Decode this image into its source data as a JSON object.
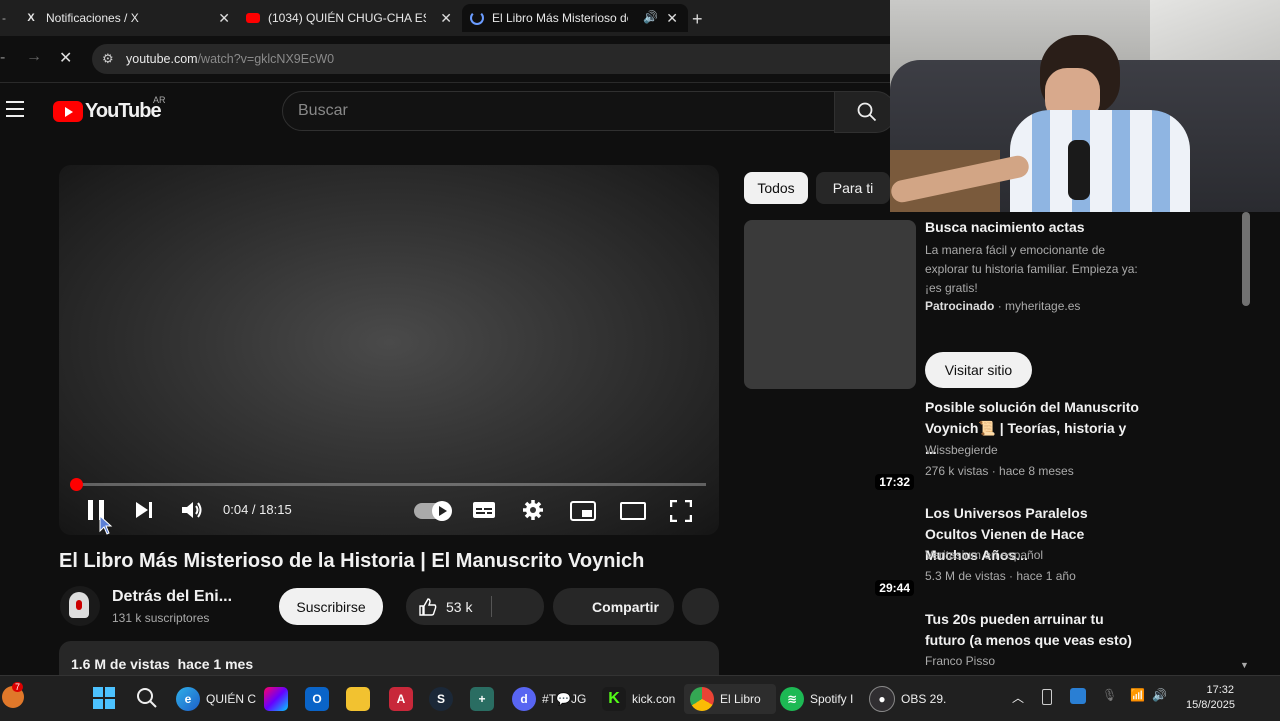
{
  "browser": {
    "tabs": [
      {
        "title": "Notificaciones / X"
      },
      {
        "title": "(1034) QUIÉN CHUG-CHA ES PA"
      },
      {
        "title": "El Libro Más Misterioso de l"
      }
    ],
    "url_host": "youtube.com",
    "url_path": "/watch?v=gklcNX9EcW0"
  },
  "header": {
    "logo_text": "YouTube",
    "country": "AR",
    "search_placeholder": "Buscar"
  },
  "player": {
    "time": "0:04 / 18:15",
    "progress": 0.0037
  },
  "video": {
    "title": "El Libro Más Misterioso de la Historia | El Manuscrito Voynich",
    "channel": "Detrás del Eni...",
    "subscribers": "131 k suscriptores",
    "subscribe_label": "Suscribirse",
    "likes": "53 k",
    "share_label": "Compartir",
    "stats": "1.6 M de vistas  hace 1 mes"
  },
  "chips": [
    "Todos",
    "Para ti"
  ],
  "ad": {
    "title": "Busca nacimiento actas",
    "desc": "La manera fácil y emocionante de explorar tu historia familiar. Empieza ya: ¡es gratis!",
    "sponsored": "Patrocinado",
    "domain": "myheritage.es",
    "cta": "Visitar sitio"
  },
  "recommendations": [
    {
      "title": "Posible solución del Manuscrito Voynich📜 | Teorías, historia y ...",
      "channel": "Wissbegierde",
      "meta": "276 k vistas · hace 8 meses",
      "duration": "17:32"
    },
    {
      "title": "Los Universos Paralelos Ocultos Vienen de Hace Muchos Años...",
      "channel": "Veritasium en español",
      "meta": "5.3 M de vistas · hace 1 año",
      "duration": "29:44"
    },
    {
      "title": "Tus 20s pueden arruinar tu futuro (a menos que veas esto)",
      "channel": "Franco Pisso",
      "meta": "",
      "duration": ""
    }
  ],
  "taskbar": {
    "notif_badge": "7",
    "items": [
      {
        "label": "QUIÉN C"
      },
      {
        "label": "#T💬JG"
      },
      {
        "label": "kick.con"
      },
      {
        "label": "El Libro"
      },
      {
        "label": "Spotify I"
      },
      {
        "label": "OBS 29."
      }
    ],
    "time": "17:32",
    "date": "15/8/2025"
  }
}
